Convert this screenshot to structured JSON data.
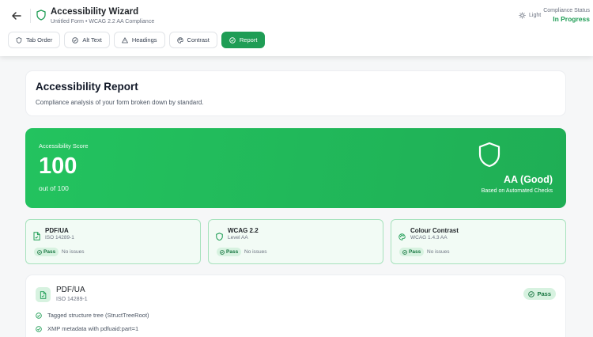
{
  "header": {
    "title": "Accessibility Wizard",
    "subtitle": "Untitled Form • WCAG 2.2 AA Compliance",
    "theme_label": "Light",
    "status_label": "Compliance Status",
    "status_value": "In Progress",
    "tabs": [
      {
        "label": "Tab Order",
        "icon": "shield-icon",
        "active": false
      },
      {
        "label": "Alt Text",
        "icon": "circle-check-icon",
        "active": false
      },
      {
        "label": "Headings",
        "icon": "warning-icon",
        "active": false
      },
      {
        "label": "Contrast",
        "icon": "palette-icon",
        "active": false
      },
      {
        "label": "Report",
        "icon": "circle-check-icon",
        "active": true
      }
    ]
  },
  "report": {
    "title": "Accessibility Report",
    "description": "Compliance analysis of your form broken down by standard."
  },
  "score": {
    "label": "Accessibility Score",
    "value": "100",
    "out_of": "out of 100",
    "level": "AA (Good)",
    "level_sub": "Based on Automated Checks"
  },
  "standards": [
    {
      "name": "PDF/UA",
      "sub": "ISO 14289-1",
      "icon": "document-icon",
      "status": "Pass",
      "issues": "No issues"
    },
    {
      "name": "WCAG 2.2",
      "sub": "Level AA",
      "icon": "shield-icon",
      "status": "Pass",
      "issues": "No issues"
    },
    {
      "name": "Colour Contrast",
      "sub": "WCAG 1.4.3 AA",
      "icon": "palette-icon",
      "status": "Pass",
      "issues": "No issues"
    }
  ],
  "detail": {
    "name": "PDF/UA",
    "sub": "ISO 14289-1",
    "status": "Pass",
    "checks": [
      "Tagged structure tree (StructTreeRoot)",
      "XMP metadata with pdfuaid:part=1"
    ]
  },
  "colors": {
    "accent": "#1f9d55",
    "score_bg": "#23c35f",
    "pass_bg": "#d7f2e0"
  }
}
